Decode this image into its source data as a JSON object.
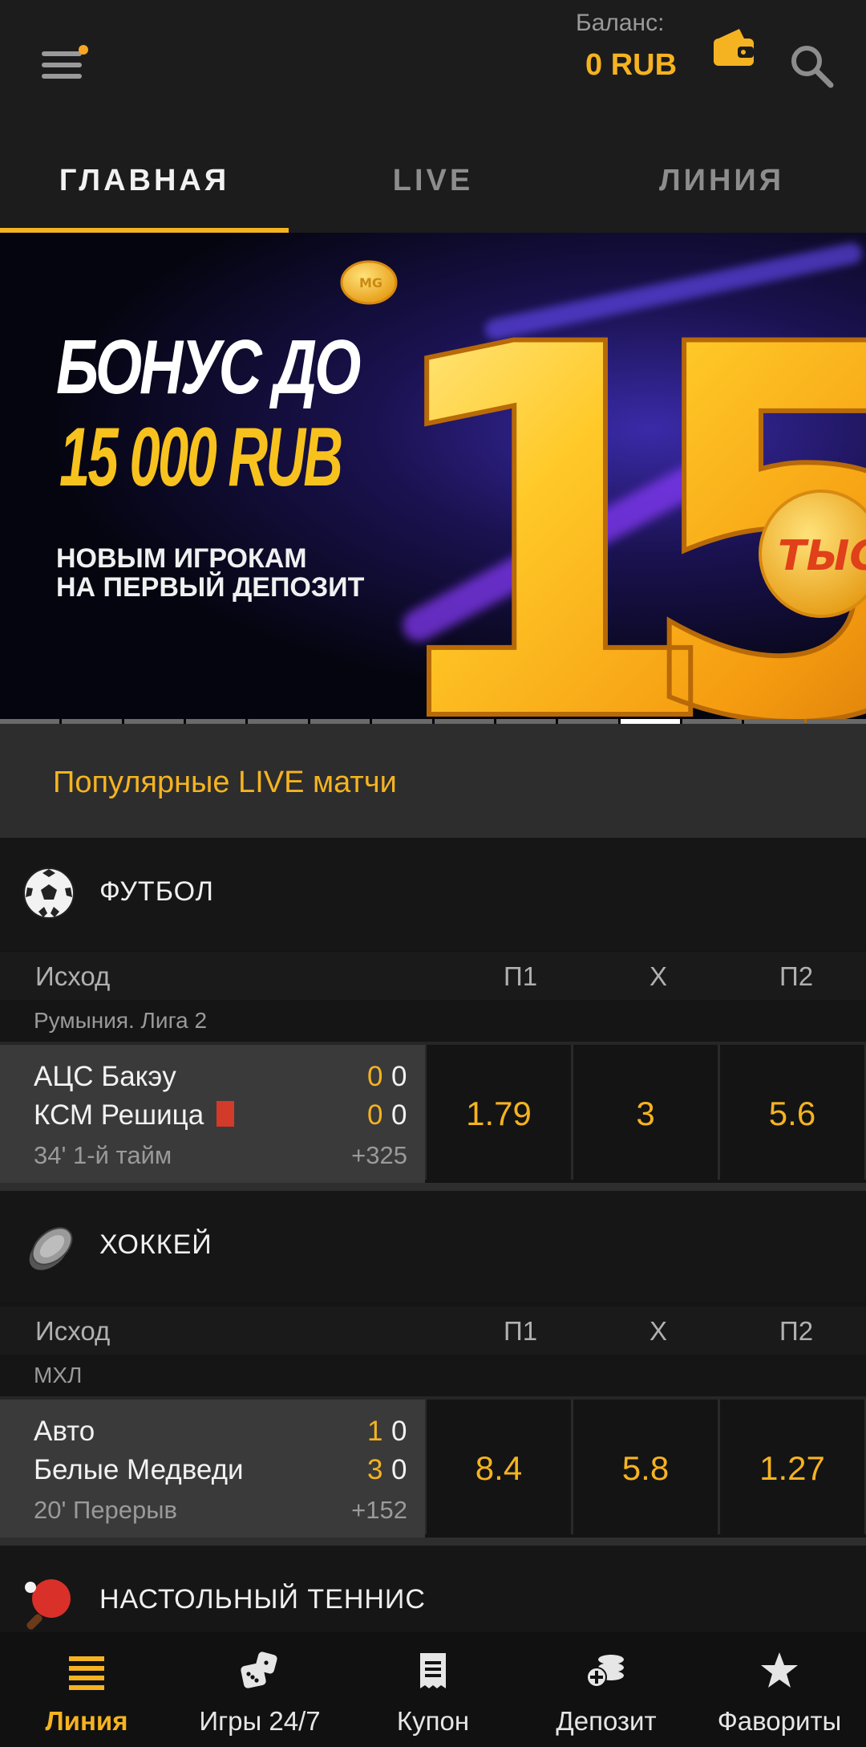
{
  "header": {
    "balance_label": "Баланс:",
    "balance_value": "0 RUB",
    "accent": "#f5b321"
  },
  "tabs": [
    {
      "label": "ГЛАВНАЯ",
      "active": true
    },
    {
      "label": "LIVE",
      "active": false
    },
    {
      "label": "ЛИНИЯ",
      "active": false
    }
  ],
  "banner": {
    "title": "БОНУС ДО",
    "amount": "15 000 RUB",
    "sub_line1": "НОВЫМ ИГРОКАМ",
    "sub_line2": "НА ПЕРВЫЙ ДЕПОЗИТ",
    "big_number": "15",
    "coin_text": "ТЫС",
    "coin_small": "MG",
    "slides_total": 14,
    "active_slide": 11
  },
  "popular": {
    "title": "Популярные LIVE матчи"
  },
  "sports": [
    {
      "name": "ФУТБОЛ",
      "icon": "soccer-ball-icon",
      "head": {
        "outcome": "Исход",
        "p1": "П1",
        "x": "Х",
        "p2": "П2"
      },
      "league": "Румыния. Лига 2",
      "match": {
        "team1": "АЦС Бакэу",
        "team2": "КСМ Решица",
        "score1_a": "0",
        "score1_b": "0",
        "score2_a": "0",
        "score2_b": "0",
        "time": "34' 1-й тайм",
        "more": "+325",
        "odds": [
          "1.79",
          "3",
          "5.6"
        ]
      }
    },
    {
      "name": "ХОККЕЙ",
      "icon": "hockey-puck-icon",
      "head": {
        "outcome": "Исход",
        "p1": "П1",
        "x": "Х",
        "p2": "П2"
      },
      "league": "МХЛ",
      "match": {
        "team1": "Авто",
        "team2": "Белые Медведи",
        "score1_a": "1",
        "score1_b": "0",
        "score2_a": "3",
        "score2_b": "0",
        "time": "20' Перерыв",
        "more": "+152",
        "odds": [
          "8.4",
          "5.8",
          "1.27"
        ]
      }
    },
    {
      "name": "НАСТОЛЬНЫЙ ТЕННИС",
      "icon": "table-tennis-icon"
    }
  ],
  "bottom_nav": [
    {
      "label": "Линия",
      "icon": "list-icon",
      "active": true
    },
    {
      "label": "Игры 24/7",
      "icon": "dice-icon",
      "active": false
    },
    {
      "label": "Купон",
      "icon": "coupon-icon",
      "active": false
    },
    {
      "label": "Депозит",
      "icon": "coins-plus-icon",
      "active": false
    },
    {
      "label": "Фавориты",
      "icon": "star-icon",
      "active": false
    }
  ]
}
